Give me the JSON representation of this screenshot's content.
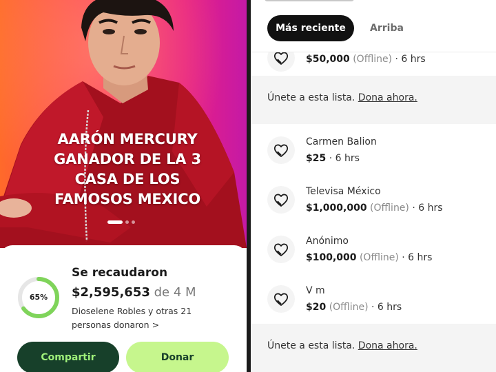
{
  "campaign": {
    "hero_title_lines": [
      "AARÓN MERCURY",
      "GANADOR DE LA 3",
      "CASA DE LOS",
      "FAMOSOS MEXICO"
    ],
    "carousel": {
      "total": 3,
      "active": 0
    },
    "progress_percent": 65,
    "progress_label": "65%",
    "raised_heading": "Se recaudaron",
    "raised_amount": "$2,595,653",
    "raised_separator": "de",
    "goal": "4 M",
    "donors_text": "Dioselene Robles y otras 21 personas donaron >",
    "share_label": "Compartir",
    "donate_label": "Donar",
    "colors": {
      "dark_green": "#17402a",
      "light_green": "#c6f68d",
      "progress": "#7fd45a"
    }
  },
  "donations_panel": {
    "tabs": [
      {
        "label": "Más reciente",
        "active": true
      },
      {
        "label": "Arriba",
        "active": false
      }
    ],
    "items": [
      {
        "name": "",
        "amount": "$50,000",
        "offline": "(Offline)",
        "time": "· 6 hrs"
      },
      {
        "join_prefix": "Únete a esta lista.",
        "join_link": "Dona ahora."
      },
      {
        "name": "Carmen Balion",
        "amount": "$25",
        "offline": "",
        "time": "· 6 hrs"
      },
      {
        "name": "Televisa México",
        "amount": "$1,000,000",
        "offline": "(Offline)",
        "time": "· 6 hrs"
      },
      {
        "name": "Anónimo",
        "amount": "$100,000",
        "offline": "(Offline)",
        "time": "· 6 hrs"
      },
      {
        "name": "V m",
        "amount": "$20",
        "offline": "(Offline)",
        "time": "· 6 hrs"
      },
      {
        "join_prefix": "Únete a esta lista.",
        "join_link": "Dona ahora."
      }
    ]
  }
}
